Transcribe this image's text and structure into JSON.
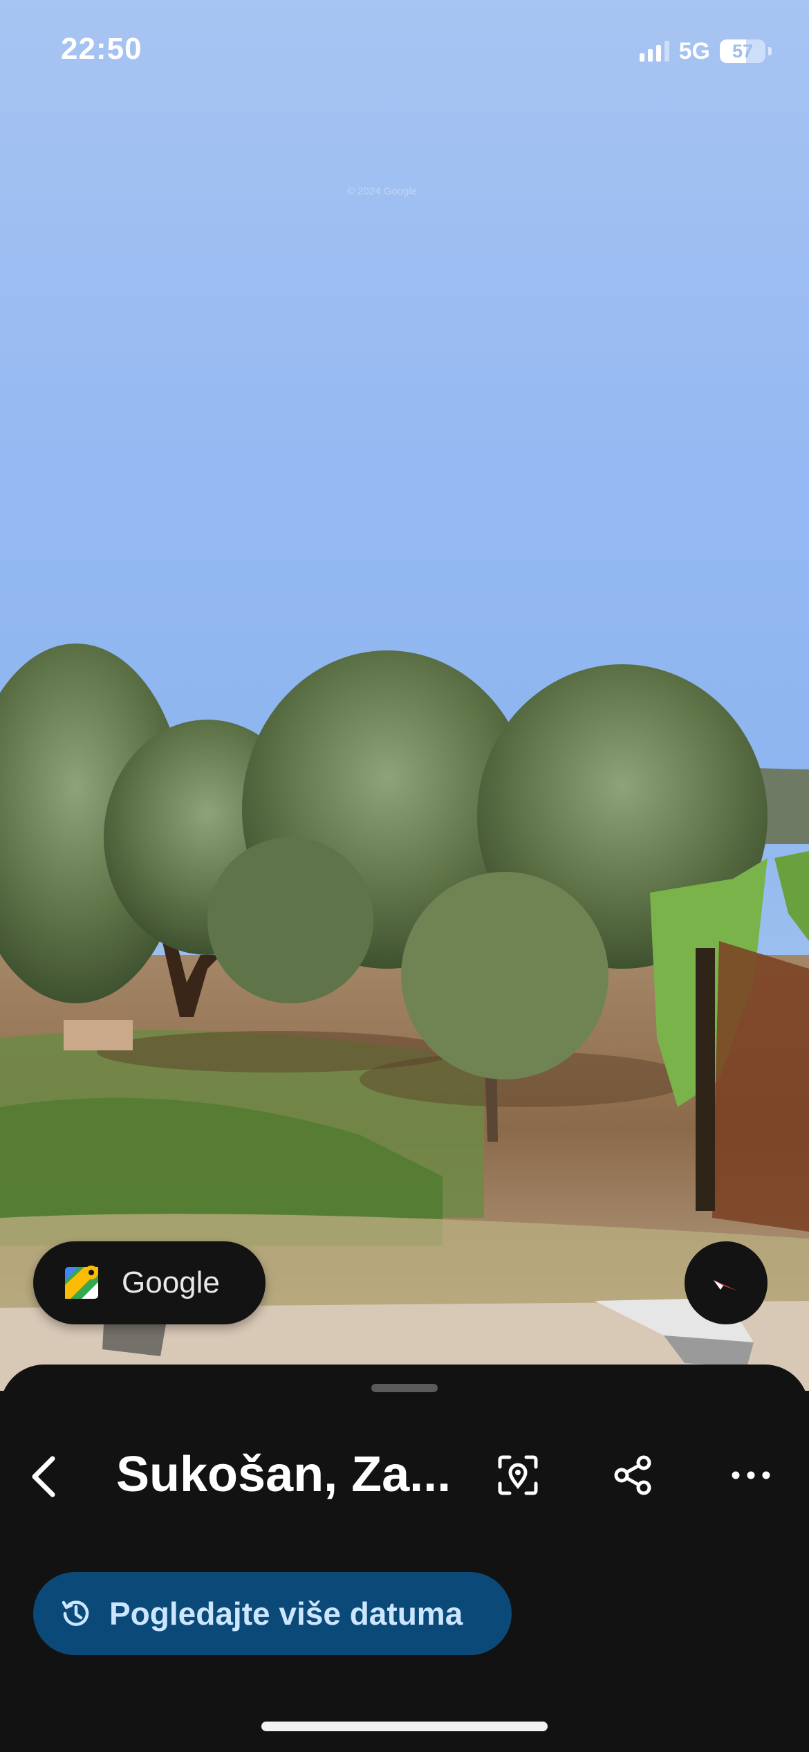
{
  "status_bar": {
    "time": "22:50",
    "network": "5G",
    "battery": "57",
    "battery_level_percent": 57
  },
  "street_view": {
    "watermark": "© 2024 Google"
  },
  "google_chip": {
    "label": "Google",
    "icon": "google-maps-icon"
  },
  "compass": {
    "icon": "compass-icon"
  },
  "sheet": {
    "title": "Sukošan, Za...",
    "back_icon": "chevron-left-icon",
    "actions": [
      {
        "icon": "location-focus-icon"
      },
      {
        "icon": "share-icon"
      },
      {
        "icon": "more-horizontal-icon"
      }
    ],
    "dates_button": {
      "label": "Pogledajte više datuma",
      "icon": "history-icon"
    }
  },
  "colors": {
    "sheet_bg": "#121212",
    "dates_button_bg": "#0b4a78",
    "dates_button_text": "#cde6ff"
  }
}
